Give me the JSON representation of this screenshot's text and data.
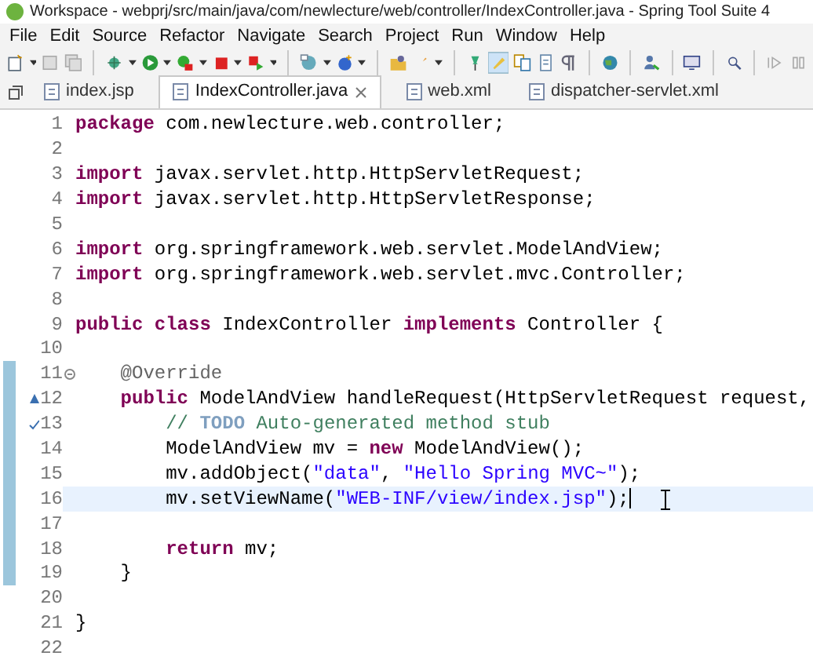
{
  "window": {
    "title": "Workspace - webprj/src/main/java/com/newlecture/web/controller/IndexController.java - Spring Tool Suite 4"
  },
  "menu": [
    "File",
    "Edit",
    "Source",
    "Refactor",
    "Navigate",
    "Search",
    "Project",
    "Run",
    "Window",
    "Help"
  ],
  "tabs": [
    {
      "label": "index.jsp",
      "selected": false
    },
    {
      "label": "IndexController.java",
      "selected": true
    },
    {
      "label": "web.xml",
      "selected": false
    },
    {
      "label": "dispatcher-servlet.xml",
      "selected": false
    }
  ],
  "editor": {
    "lines": [
      {
        "number": "1",
        "changed": false,
        "current": false,
        "tokens": [
          {
            "kind": "kw",
            "text": "package"
          },
          {
            "kind": "plain",
            "text": " com.newlecture.web.controller;"
          }
        ]
      },
      {
        "number": "2",
        "changed": false,
        "current": false
      },
      {
        "number": "3",
        "changed": false,
        "current": false,
        "tokens": [
          {
            "kind": "kw",
            "text": "import"
          },
          {
            "kind": "plain",
            "text": " javax.servlet.http.HttpServletRequest;"
          }
        ]
      },
      {
        "number": "4",
        "changed": false,
        "current": false,
        "tokens": [
          {
            "kind": "kw",
            "text": "import"
          },
          {
            "kind": "plain",
            "text": " javax.servlet.http.HttpServletResponse;"
          }
        ]
      },
      {
        "number": "5",
        "changed": false,
        "current": false
      },
      {
        "number": "6",
        "changed": false,
        "current": false,
        "tokens": [
          {
            "kind": "kw",
            "text": "import"
          },
          {
            "kind": "plain",
            "text": " org.springframework.web.servlet.ModelAndView;"
          }
        ]
      },
      {
        "number": "7",
        "changed": false,
        "current": false,
        "tokens": [
          {
            "kind": "kw",
            "text": "import"
          },
          {
            "kind": "plain",
            "text": " org.springframework.web.servlet.mvc.Controller;"
          }
        ]
      },
      {
        "number": "8",
        "changed": false,
        "current": false
      },
      {
        "number": "9",
        "changed": false,
        "current": false,
        "tokens": [
          {
            "kind": "kw",
            "text": "public class"
          },
          {
            "kind": "plain",
            "text": " IndexController "
          },
          {
            "kind": "kw",
            "text": "implements"
          },
          {
            "kind": "plain",
            "text": " Controller {"
          }
        ]
      },
      {
        "number": "10",
        "changed": false,
        "current": false
      },
      {
        "number": "11",
        "changed": true,
        "current": false,
        "foldable": true,
        "tokens": [
          {
            "kind": "ann",
            "text": "    @Override"
          }
        ]
      },
      {
        "number": "12",
        "changed": true,
        "current": false,
        "override_marker": true,
        "tokens": [
          {
            "kind": "kw",
            "text": "    public"
          },
          {
            "kind": "plain",
            "text": " ModelAndView handleRequest(HttpServletRequest request,"
          }
        ]
      },
      {
        "number": "13",
        "changed": true,
        "current": false,
        "task_marker": true,
        "tokens": [
          {
            "kind": "comment",
            "text": "        // "
          },
          {
            "kind": "todo",
            "text": "TODO"
          },
          {
            "kind": "comment",
            "text": " Auto-generated method stub"
          }
        ]
      },
      {
        "number": "14",
        "changed": true,
        "current": false,
        "tokens": [
          {
            "kind": "plain",
            "text": "        ModelAndView mv = "
          },
          {
            "kind": "kw",
            "text": "new"
          },
          {
            "kind": "plain",
            "text": " ModelAndView();"
          }
        ]
      },
      {
        "number": "15",
        "changed": true,
        "current": false,
        "tokens": [
          {
            "kind": "plain",
            "text": "        mv.addObject("
          },
          {
            "kind": "str",
            "text": "\"data\""
          },
          {
            "kind": "plain",
            "text": ", "
          },
          {
            "kind": "str",
            "text": "\"Hello Spring MVC~\""
          },
          {
            "kind": "plain",
            "text": ");"
          }
        ]
      },
      {
        "number": "16",
        "changed": true,
        "current": true,
        "tokens": [
          {
            "kind": "plain",
            "text": "        mv.setViewName("
          },
          {
            "kind": "str",
            "text": "\"WEB-INF/view/index.jsp\""
          },
          {
            "kind": "plain",
            "text": ");"
          }
        ]
      },
      {
        "number": "17",
        "changed": true,
        "current": false
      },
      {
        "number": "18",
        "changed": true,
        "current": false,
        "tokens": [
          {
            "kind": "kw",
            "text": "        return"
          },
          {
            "kind": "plain",
            "text": " mv;"
          }
        ]
      },
      {
        "number": "19",
        "changed": true,
        "current": false,
        "tokens": [
          {
            "kind": "plain",
            "text": "    }"
          }
        ]
      },
      {
        "number": "20",
        "changed": false,
        "current": false
      },
      {
        "number": "21",
        "changed": false,
        "current": false,
        "tokens": [
          {
            "kind": "plain",
            "text": "}"
          }
        ]
      },
      {
        "number": "22",
        "changed": false,
        "current": false
      }
    ]
  }
}
